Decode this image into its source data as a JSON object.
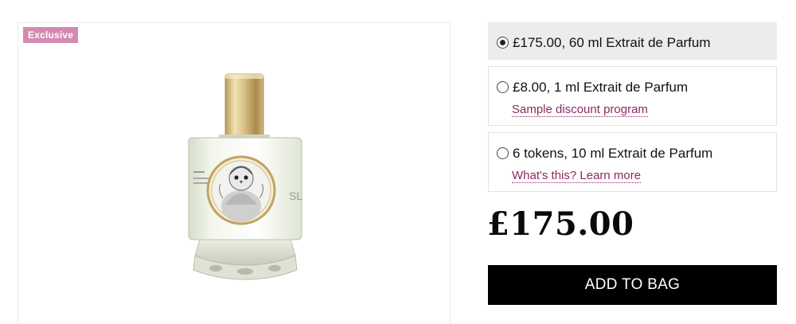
{
  "product": {
    "badge": "Exclusive",
    "image_alt": "Perfume bottle with owl illustration label",
    "price": "£175.00",
    "add_to_bag_label": "ADD TO BAG"
  },
  "options": [
    {
      "label": "£175.00, 60 ml Extrait de Parfum",
      "selected": true,
      "link": ""
    },
    {
      "label": "£8.00, 1 ml Extrait de Parfum",
      "selected": false,
      "link": "Sample discount program"
    },
    {
      "label": "6 tokens, 10 ml Extrait de Parfum",
      "selected": false,
      "link": "What's this? Learn more"
    }
  ],
  "colors": {
    "badge_bg": "#d48ab0",
    "link": "#8a2a5e",
    "selected_bg": "#ececec",
    "button_bg": "#000000"
  }
}
